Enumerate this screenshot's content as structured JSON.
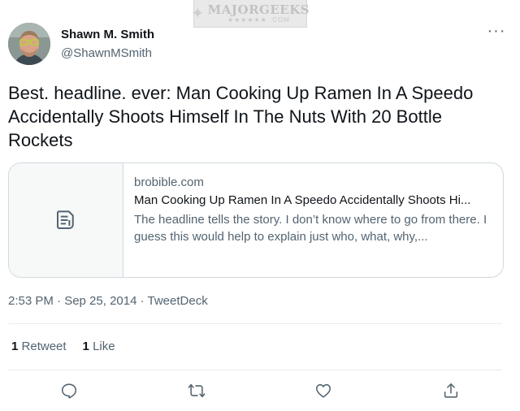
{
  "watermark": {
    "main": "MAJORGEEKS",
    "sub": "★★★★★★ .COM"
  },
  "author": {
    "display_name": "Shawn M. Smith",
    "handle": "@ShawnMSmith"
  },
  "tweet": {
    "text": "Best. headline. ever: Man Cooking Up Ramen In A Speedo Accidentally Shoots Himself In The Nuts With 20 Bottle Rockets"
  },
  "card": {
    "domain": "brobible.com",
    "title": "Man Cooking Up Ramen In A Speedo Accidentally Shoots Hi...",
    "description": "The headline tells the story. I don’t know where to go from there. I guess this would help to explain just who, what, why,...",
    "thumb_icon": "document-icon"
  },
  "meta": {
    "timestamp": "2:53 PM · Sep 25, 2014 · TweetDeck"
  },
  "stats": {
    "retweet_count": "1",
    "retweet_label": "Retweet",
    "like_count": "1",
    "like_label": "Like"
  },
  "actions": [
    "reply-icon",
    "retweet-icon",
    "like-icon",
    "share-icon"
  ],
  "colors": {
    "text": "#0f1419",
    "secondary": "#536471",
    "border": "#cfd9de",
    "divider": "#e6ecf0"
  }
}
